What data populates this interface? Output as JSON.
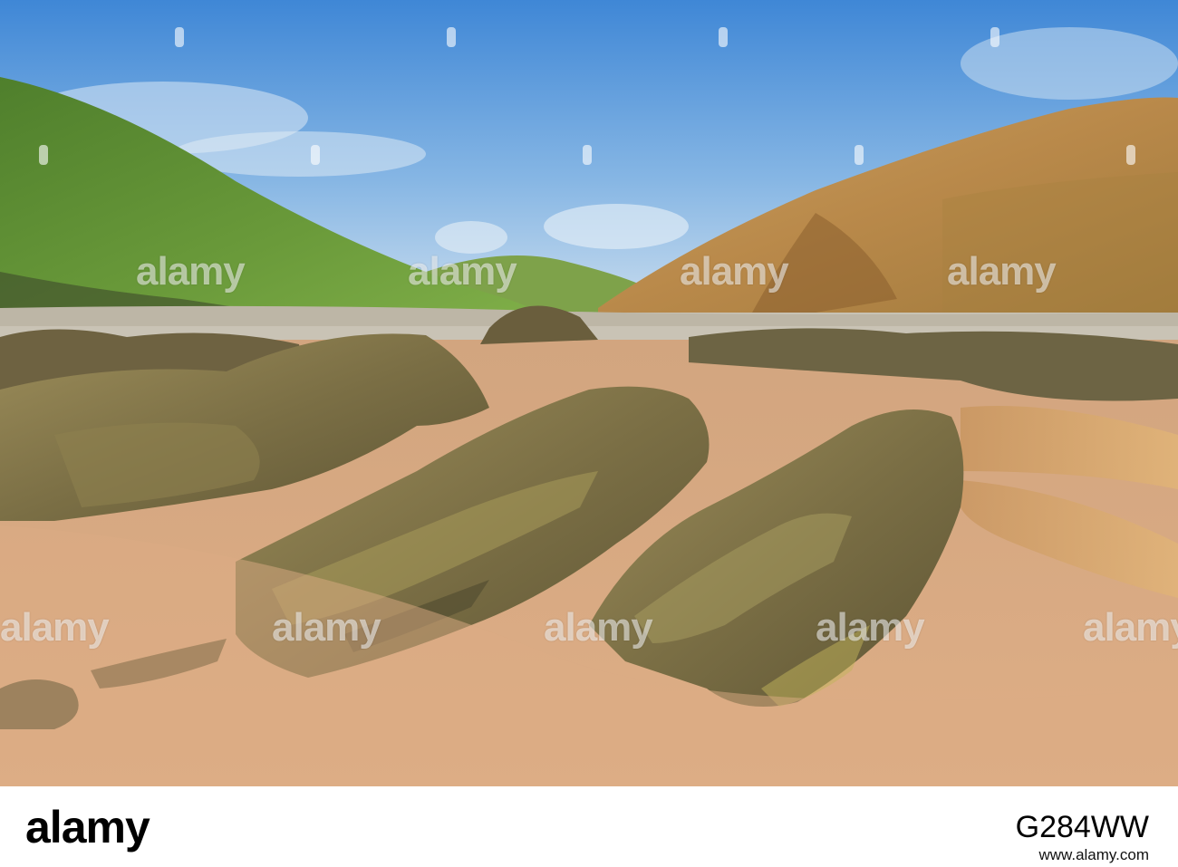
{
  "photo": {
    "scene": [
      "sky",
      "grassy-hill-left",
      "grassy-hill-right-sunlit",
      "distant-hill",
      "pebble-cove",
      "rocky-outcrops",
      "wet-sand",
      "tidal-pools"
    ],
    "colors": {
      "sky_top": "#3f87d6",
      "sky_bottom": "#cfe0ef",
      "grass": "#6a9a3a",
      "cliff": "#b98a4a",
      "sand": "#d9a77d",
      "rock": "#7b6f45"
    }
  },
  "watermark": {
    "text": "alamy"
  },
  "footer": {
    "logo_text": "alamy",
    "image_id": "G284WW",
    "url": "www.alamy.com"
  }
}
